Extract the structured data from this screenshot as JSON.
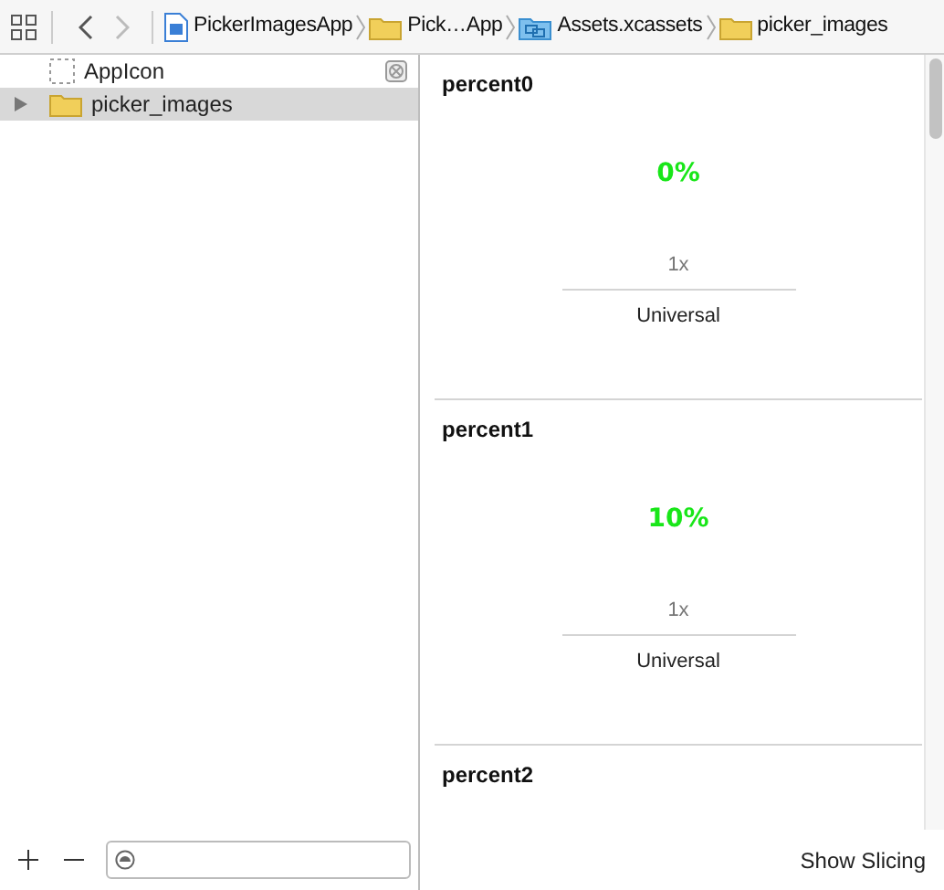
{
  "toolbar": {
    "back": {
      "disabled": false
    },
    "forward": {
      "disabled": true
    }
  },
  "breadcrumbs": [
    {
      "kind": "project",
      "label": "PickerImagesApp"
    },
    {
      "kind": "folder",
      "label": "Pick…App"
    },
    {
      "kind": "catalog",
      "label": "Assets.xcassets"
    },
    {
      "kind": "folder",
      "label": "picker_images"
    }
  ],
  "sidebar": {
    "items": [
      {
        "kind": "appicon",
        "label": "AppIcon",
        "selected": false
      },
      {
        "kind": "folder",
        "label": "picker_images",
        "selected": true,
        "expanded": false
      }
    ]
  },
  "image_sets": [
    {
      "name": "percent0",
      "image": "0%",
      "scale": "1x",
      "idiom": "Universal"
    },
    {
      "name": "percent1",
      "image": "10%",
      "scale": "1x",
      "idiom": "Universal"
    },
    {
      "name": "percent2"
    }
  ],
  "bottom_bar": {
    "show_slicing": "Show Slicing"
  }
}
